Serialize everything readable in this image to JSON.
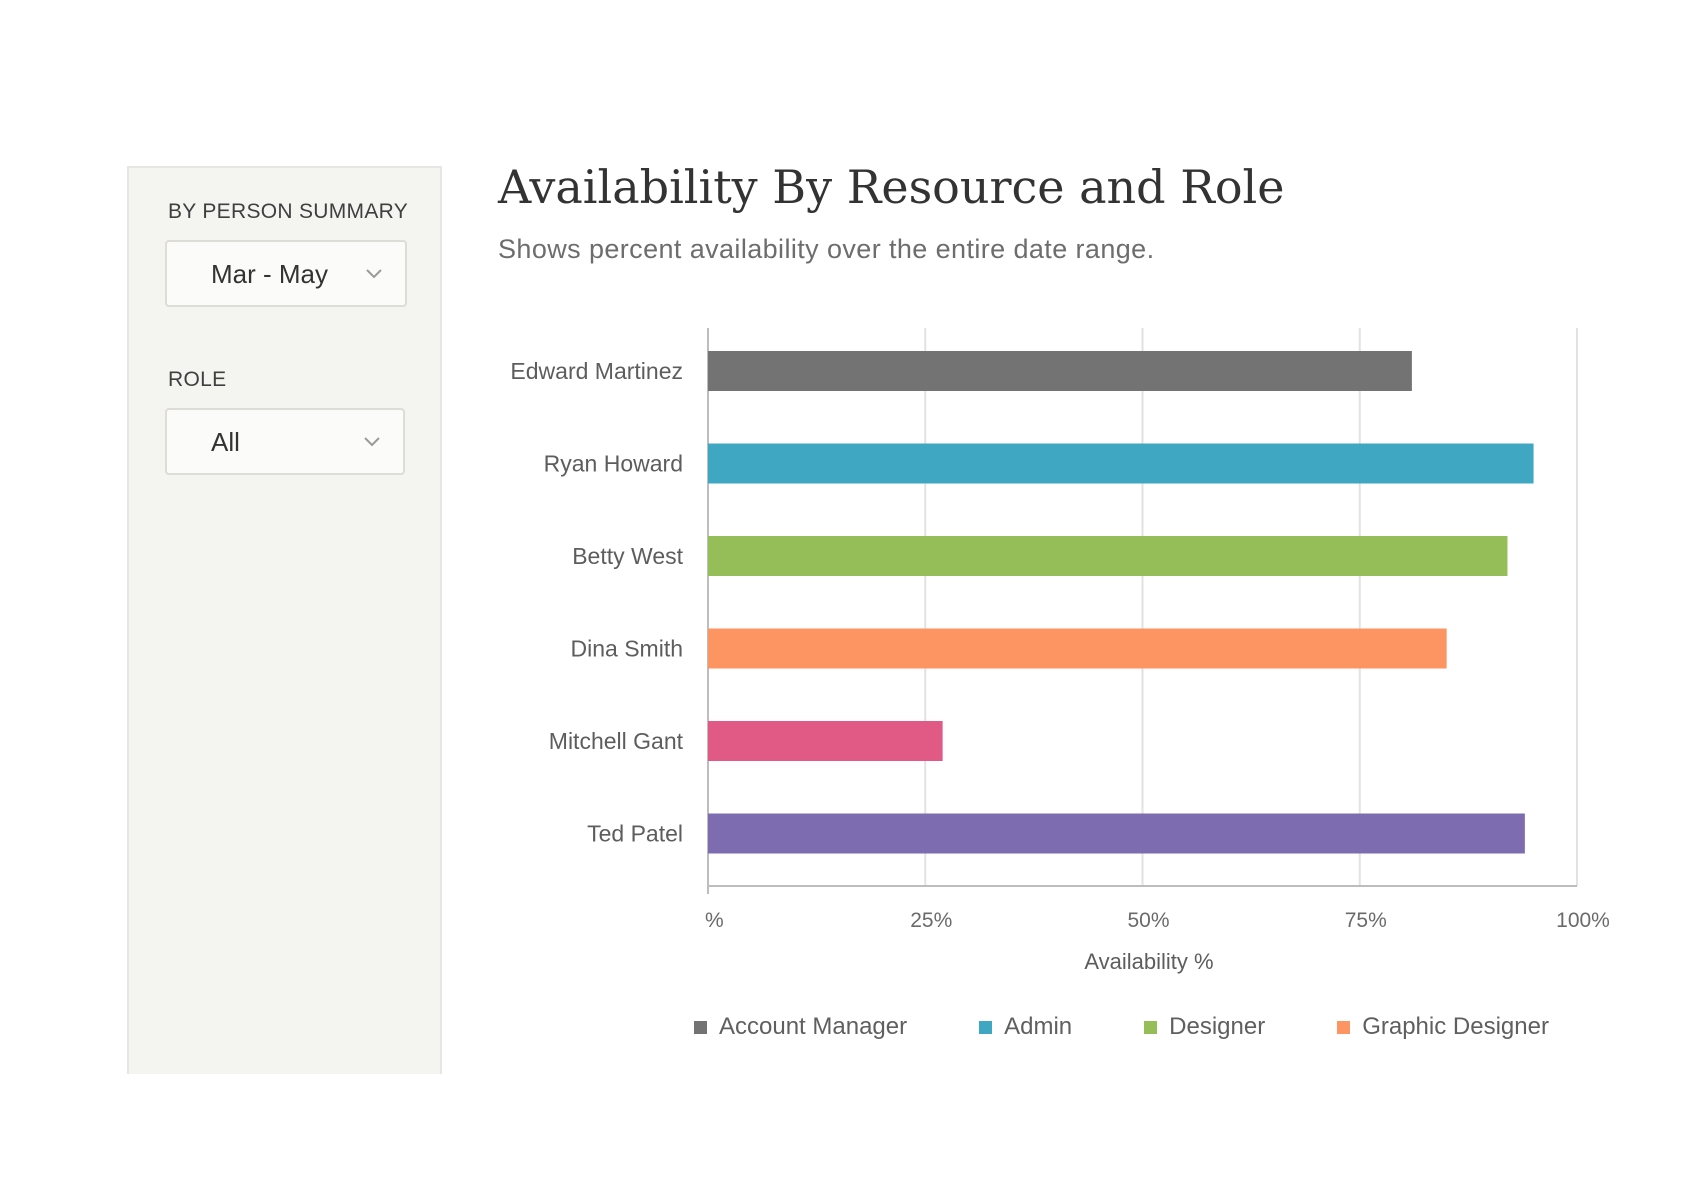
{
  "sidebar": {
    "period_label": "BY PERSON SUMMARY",
    "period_value": "Mar - May",
    "role_label": "ROLE",
    "role_value": "All"
  },
  "header": {
    "title": "Availability By Resource and Role",
    "subtitle": "Shows percent availability over the entire date range."
  },
  "legend": [
    {
      "label": "Account Manager",
      "color": "#737373"
    },
    {
      "label": "Admin",
      "color": "#3fa7c1"
    },
    {
      "label": "Designer",
      "color": "#95be58"
    },
    {
      "label": "Graphic Designer",
      "color": "#fd9562"
    }
  ],
  "chart_data": {
    "type": "bar",
    "orientation": "horizontal",
    "categories": [
      "Edward Martinez",
      "Ryan Howard",
      "Betty West",
      "Dina Smith",
      "Mitchell Gant",
      "Ted Patel"
    ],
    "values": [
      81,
      95,
      92,
      85,
      27,
      94
    ],
    "colors": [
      "#737373",
      "#3fa7c1",
      "#95be58",
      "#fd9562",
      "#e15985",
      "#7d6cb0"
    ],
    "xlabel": "Availability %",
    "xlim": [
      0,
      100
    ],
    "xticks": [
      0,
      25,
      50,
      75,
      100
    ],
    "xtick_labels": [
      "%",
      "25%",
      "50%",
      "75%",
      "100%"
    ],
    "grid": true,
    "legend_position": "bottom"
  }
}
